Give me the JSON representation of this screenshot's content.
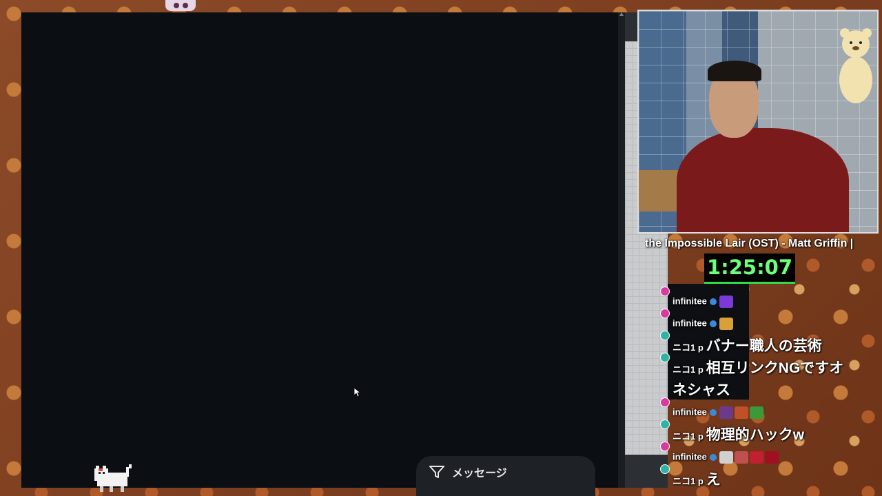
{
  "stream": {
    "now_playing": "the Impossible Lair (OST) - Matt Griffin |",
    "timer": "1:25:07"
  },
  "message_bar": {
    "icon": "filter-icon",
    "label": "メッセージ"
  },
  "chat": [
    {
      "badge_color": "#d83a9f",
      "user": "infinitee",
      "text": "",
      "emote_colors": [
        "#7a3ad9"
      ]
    },
    {
      "badge_color": "#d83a9f",
      "user": "infinitee",
      "text": "",
      "emote_colors": [
        "#d9a03a"
      ]
    },
    {
      "badge_color": "#2fb3a6",
      "user": "ニコ1 p",
      "text": "バナー職人の芸術",
      "emote_colors": []
    },
    {
      "badge_color": "#2fb3a6",
      "user": "ニコ1 p",
      "text": "相互リンクNGですオ",
      "continuation": "ネシャス",
      "emote_colors": []
    },
    {
      "badge_color": "#d83a9f",
      "user": "infinitee",
      "text": "",
      "emote_colors": [
        "#6b3a8a",
        "#c0502a",
        "#3a9a3a"
      ]
    },
    {
      "badge_color": "#2fb3a6",
      "user": "ニコ1 p",
      "text": "物理的ハックw",
      "emote_colors": []
    },
    {
      "badge_color": "#d83a9f",
      "user": "infinitee",
      "text": "",
      "emote_colors": [
        "#d0d0d0",
        "#c05050",
        "#c02030",
        "#a01020"
      ]
    },
    {
      "badge_color": "#2fb3a6",
      "user": "ニコ1 p",
      "text": "え",
      "emote_colors": []
    }
  ],
  "colors": {
    "main_panel": "#0b0e13",
    "timer_text": "#6cff7a",
    "timer_bar": "#2fdc4a"
  }
}
